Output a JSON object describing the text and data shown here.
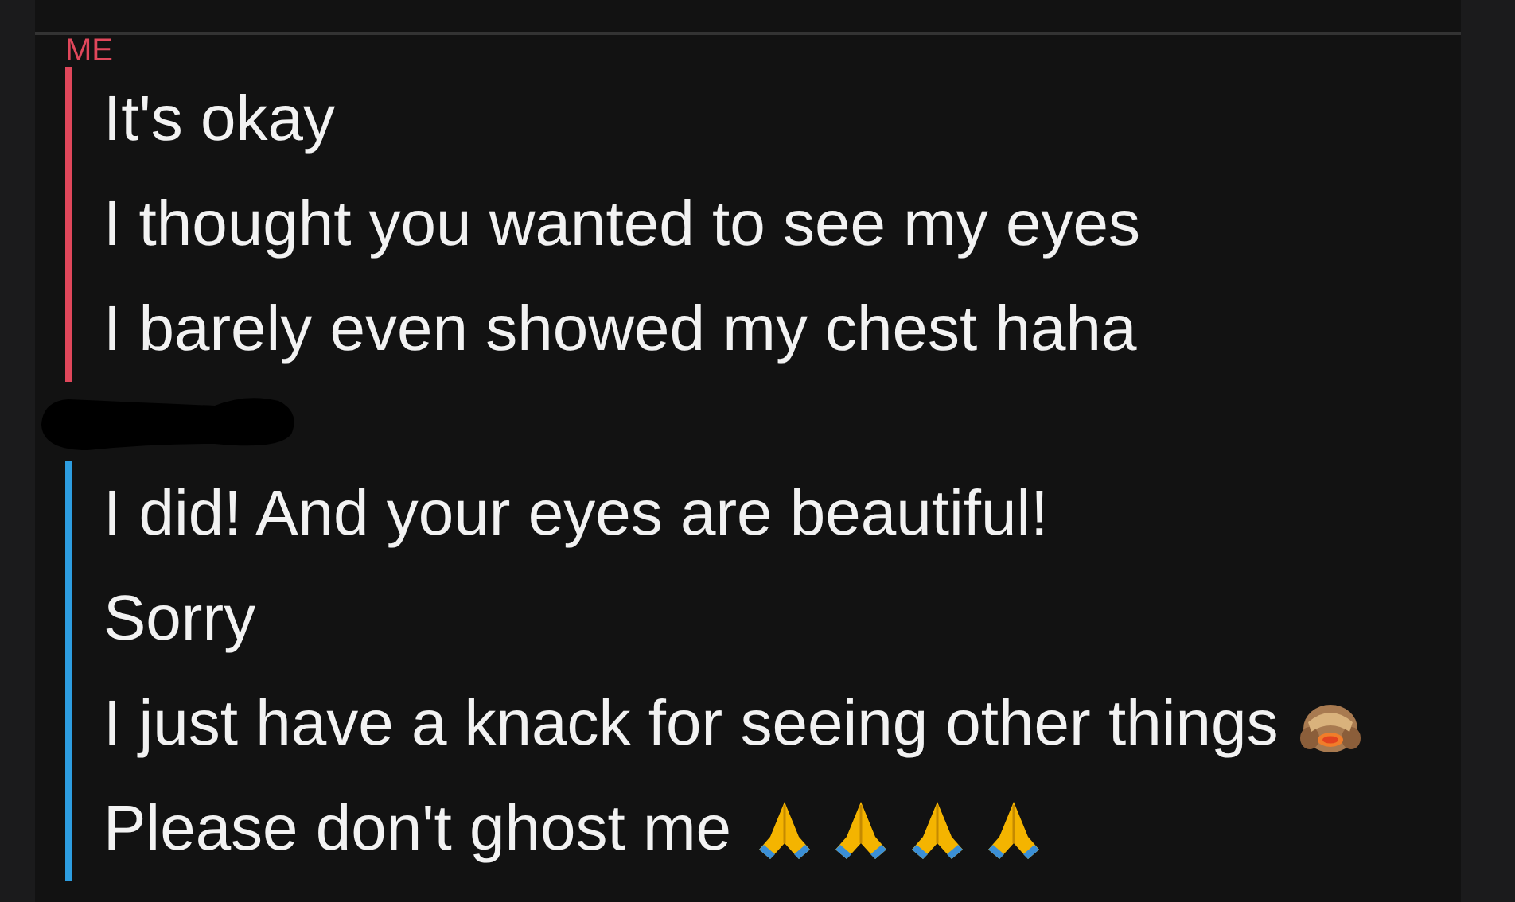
{
  "groups": [
    {
      "sender": "ME",
      "color": "#e0475b",
      "messages": [
        {
          "text": "It's okay"
        },
        {
          "text": "I thought you wanted to see my eyes"
        },
        {
          "text": "I barely even showed my chest haha"
        }
      ]
    },
    {
      "color": "#2d9de0",
      "sender_redacted": true,
      "messages": [
        {
          "text": "I did! And your eyes are beautiful!"
        },
        {
          "text": "Sorry"
        },
        {
          "text": "I just have a knack for seeing other things",
          "icons": [
            {
              "kind": "see-no-evil-monkey"
            }
          ]
        },
        {
          "text": "Please don't ghost me",
          "icons": [
            {
              "kind": "praying-hands"
            },
            {
              "kind": "praying-hands"
            },
            {
              "kind": "praying-hands"
            },
            {
              "kind": "praying-hands"
            }
          ]
        }
      ]
    }
  ]
}
